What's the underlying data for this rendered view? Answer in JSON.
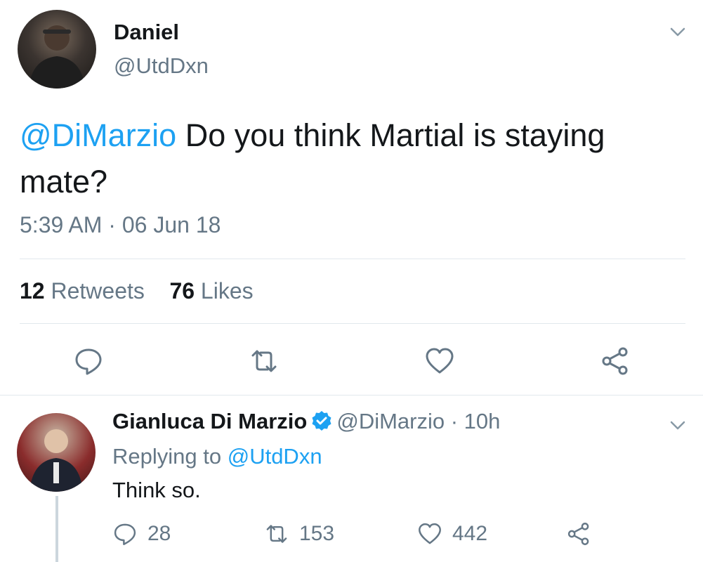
{
  "main_tweet": {
    "author_name": "Daniel",
    "author_handle": "@UtdDxn",
    "mention": "@DiMarzio",
    "text": " Do you think Martial is staying mate?",
    "timestamp": "5:39 AM · 06 Jun 18",
    "stats": {
      "retweets_count": "12",
      "retweets_label": "Retweets",
      "likes_count": "76",
      "likes_label": "Likes"
    },
    "actions": [
      "reply-icon",
      "retweet-icon",
      "like-icon",
      "share-icon"
    ]
  },
  "reply_tweet": {
    "author_name": "Gianluca Di Marzio",
    "verified": true,
    "meta": "@DiMarzio · 10h",
    "replying_to_prefix": "Replying to ",
    "replying_to_handle": "@UtdDxn",
    "text": "Think so.",
    "reply_count": "28",
    "retweet_count": "153",
    "like_count": "442"
  },
  "colors": {
    "link": "#1da1f2",
    "secondary_text": "#657786",
    "primary_text": "#14171a",
    "divider": "#e1e8ed",
    "verified": "#1da1f2"
  }
}
